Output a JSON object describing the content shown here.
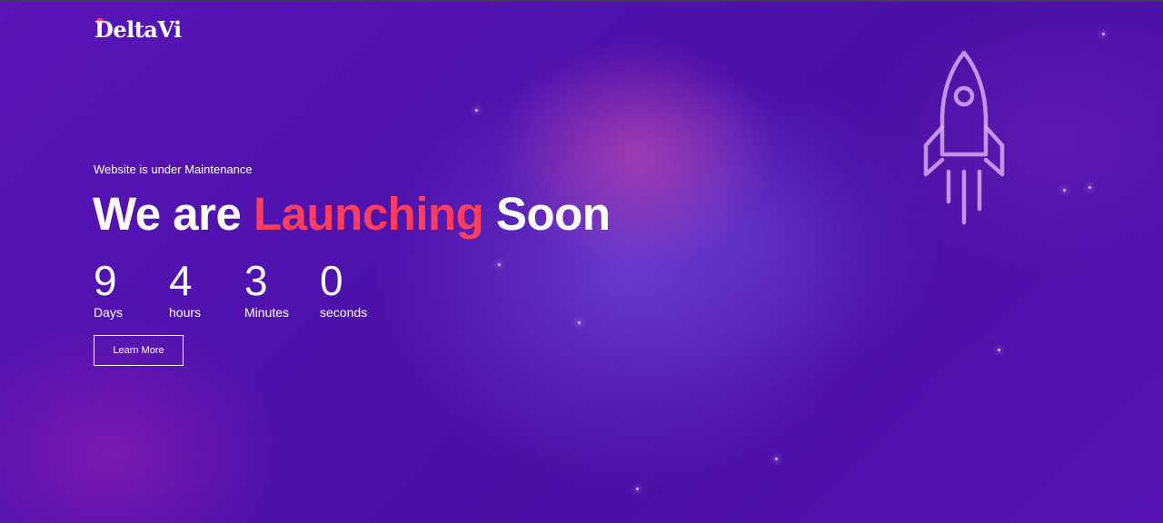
{
  "brand": {
    "name": "DeltaVi",
    "accent_color": "#ff3c6c"
  },
  "hero": {
    "subheading": "Website is under Maintenance",
    "headline_before": "We are ",
    "headline_highlight": "Launching",
    "headline_after": " Soon",
    "highlight_color": "#ff3d5f"
  },
  "countdown": {
    "days": {
      "value": "9",
      "label": "Days"
    },
    "hours": {
      "value": "4",
      "label": "hours"
    },
    "minutes": {
      "value": "3",
      "label": "Minutes"
    },
    "seconds": {
      "value": "0",
      "label": "seconds"
    }
  },
  "actions": {
    "learn_more_label": "Learn More"
  },
  "icons": {
    "rocket": "rocket-icon"
  },
  "colors": {
    "background": "#4b10a8",
    "text": "#ffffff"
  }
}
